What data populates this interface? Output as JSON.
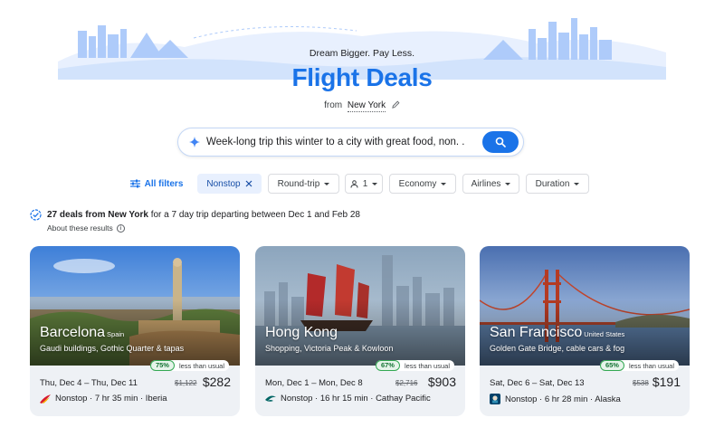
{
  "hero": {
    "tagline": "Dream Bigger. Pay Less.",
    "title": "Flight Deals",
    "from_prefix": "from",
    "from_city": "New York"
  },
  "search": {
    "query": "Week-long trip this winter to a city with great food, non. .",
    "icon": "sparkle-icon",
    "button_icon": "search-icon"
  },
  "filters": {
    "all_filters": "All filters",
    "nonstop": "Nonstop",
    "trip_type": "Round-trip",
    "passengers": "1",
    "cabin": "Economy",
    "airlines": "Airlines",
    "duration": "Duration"
  },
  "results": {
    "count_text": "27 deals from New York",
    "detail_text": "for a 7 day trip departing between Dec 1 and Feb 28",
    "about": "About these results"
  },
  "cards": [
    {
      "city": "Barcelona",
      "country": "Spain",
      "description": "Gaudi buildings, Gothic Quarter & tapas",
      "percent": "75%",
      "less_text": "less than usual",
      "dates": "Thu, Dec 4 – Thu, Dec 11",
      "old_price": "$1,122",
      "price": "$282",
      "flight": "Nonstop · 7 hr 35 min · Iberia",
      "airline_icon": "iberia-logo-icon"
    },
    {
      "city": "Hong Kong",
      "country": "",
      "description": "Shopping, Victoria Peak & Kowloon",
      "percent": "67%",
      "less_text": "less than usual",
      "dates": "Mon, Dec 1 – Mon, Dec 8",
      "old_price": "$2,716",
      "price": "$903",
      "flight": "Nonstop · 16 hr 15 min · Cathay Pacific",
      "airline_icon": "cathay-pacific-logo-icon"
    },
    {
      "city": "San Francisco",
      "country": "United States",
      "description": "Golden Gate Bridge, cable cars & fog",
      "percent": "65%",
      "less_text": "less than usual",
      "dates": "Sat, Dec 6 – Sat, Dec 13",
      "old_price": "$538",
      "price": "$191",
      "flight": "Nonstop · 6 hr 28 min · Alaska",
      "airline_icon": "alaska-logo-icon"
    }
  ],
  "colors": {
    "brand_blue": "#1a73e8",
    "chip_selected": "#e8f0fe",
    "deal_green": "#137333"
  }
}
